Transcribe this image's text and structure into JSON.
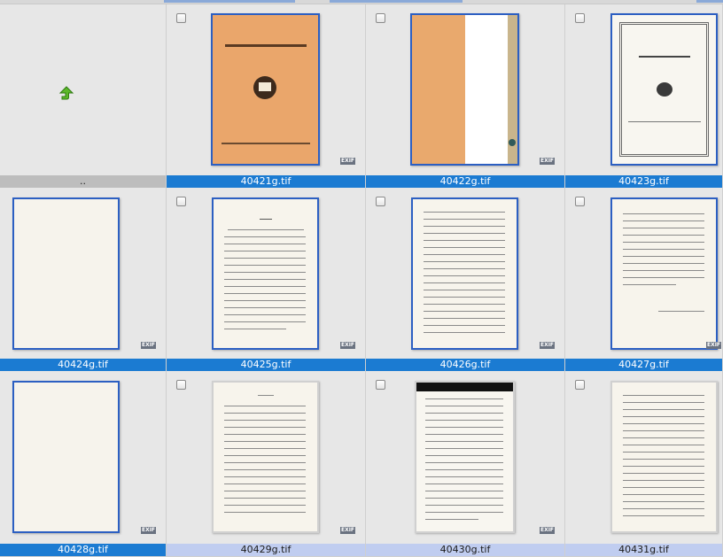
{
  "parent": {
    "label": ".."
  },
  "files": [
    {
      "name": "40421g.tif",
      "badge": "EXIF"
    },
    {
      "name": "40422g.tif",
      "badge": "EXIF"
    },
    {
      "name": "40423g.tif",
      "badge": ""
    },
    {
      "name": "40424g.tif",
      "badge": "EXIF"
    },
    {
      "name": "40425g.tif",
      "badge": "EXIF"
    },
    {
      "name": "40426g.tif",
      "badge": "EXIF"
    },
    {
      "name": "40427g.tif",
      "badge": "EXIF"
    },
    {
      "name": "40428g.tif",
      "badge": "EXIF"
    },
    {
      "name": "40429g.tif",
      "badge": "EXIF"
    },
    {
      "name": "40430g.tif",
      "badge": "EXIF"
    },
    {
      "name": "40431g.tif",
      "badge": ""
    }
  ],
  "colors": {
    "selected": "#1b7bd2",
    "unselected": "#c0cdf0",
    "cover": "#eaa66b"
  },
  "icons": {
    "parent": "up-arrow-icon",
    "badge": "exif-icon"
  }
}
